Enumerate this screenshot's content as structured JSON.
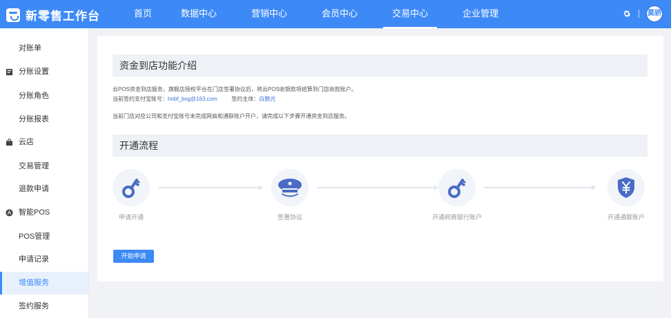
{
  "header": {
    "app_title": "新零售工作台",
    "nav": [
      "首页",
      "数据中心",
      "营销中心",
      "会员中心",
      "交易中心",
      "企业管理"
    ],
    "active_nav": "交易中心",
    "user_avatar": "莫骄",
    "brand_color": "#3d8af7"
  },
  "sidebar": {
    "items": [
      {
        "label": "对账单",
        "type": "item"
      },
      {
        "label": "分账设置",
        "type": "group",
        "icon": "ledger-icon"
      },
      {
        "label": "分账角色",
        "type": "item"
      },
      {
        "label": "分账报表",
        "type": "item"
      },
      {
        "label": "云店",
        "type": "group",
        "icon": "shop-bag-icon"
      },
      {
        "label": "交易管理",
        "type": "item"
      },
      {
        "label": "退款申请",
        "type": "item"
      },
      {
        "label": "智能POS",
        "type": "group",
        "icon": "pos-icon"
      },
      {
        "label": "POS管理",
        "type": "item"
      },
      {
        "label": "申请记录",
        "type": "item"
      },
      {
        "label": "增值服务",
        "type": "item",
        "active": true
      },
      {
        "label": "签约服务",
        "type": "item"
      }
    ]
  },
  "main": {
    "intro_title": "资金到店功能介绍",
    "intro_line1": "云POS资金到店服务，旗舰店授权平台在门店签署协议后，将云POS收银款项结算到门店收款账户。",
    "account_label": "当前签约支付宝账号：",
    "account_value": "hnbf_bxg@163.com",
    "subject_label": "签约主体：",
    "subject_value": "白鹅光",
    "intro_line3": "当前门店对应公司和支付宝账号未完成网商和通联账户开户，请完成以下步骤开通资金到店服务。",
    "process_title": "开通流程",
    "steps": [
      {
        "label": "申请开通",
        "icon": "key-icon"
      },
      {
        "label": "签署协议",
        "icon": "officer-cap-icon"
      },
      {
        "label": "开通网商银行账户",
        "icon": "key-icon"
      },
      {
        "label": "开通通联账户",
        "icon": "yuan-shield-icon"
      }
    ],
    "start_button": "开始申请"
  }
}
